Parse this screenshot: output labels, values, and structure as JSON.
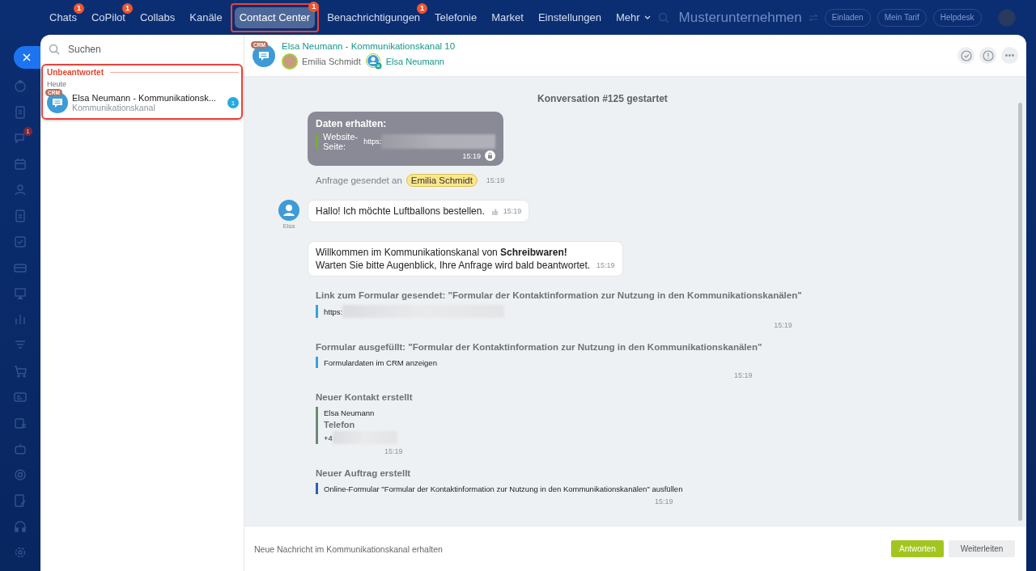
{
  "top_nav": {
    "items": [
      {
        "label": "Chats",
        "badge": "1",
        "selected": false,
        "highlighted": false
      },
      {
        "label": "CoPilot",
        "badge": "1",
        "selected": false,
        "highlighted": false
      },
      {
        "label": "Collabs",
        "selected": false,
        "highlighted": false
      },
      {
        "label": "Kanäle",
        "selected": false,
        "highlighted": false
      },
      {
        "label": "Contact Center",
        "badge": "1",
        "selected": true,
        "highlighted": true
      },
      {
        "label": "Benachrichtigungen",
        "badge": "1",
        "selected": false,
        "highlighted": false
      },
      {
        "label": "Telefonie",
        "selected": false,
        "highlighted": false
      },
      {
        "label": "Market",
        "selected": false,
        "highlighted": false
      },
      {
        "label": "Einstellungen",
        "selected": false,
        "highlighted": false
      },
      {
        "label": "Mehr",
        "kind": "dropdown",
        "selected": false,
        "highlighted": false
      }
    ]
  },
  "header_right": {
    "company": "Musterunternehmen",
    "buttons": [
      "Einladen",
      "Mein Tarif",
      "Helpdesk"
    ]
  },
  "rail": {
    "chat_badge": "1"
  },
  "list_panel": {
    "search": {
      "placeholder": "Suchen"
    },
    "unanswered": {
      "label": "Unbeantwortet",
      "highlighted": true,
      "groups": [
        {
          "label": "Heute",
          "items": [
            {
              "tag": "CRM",
              "title": "Elsa Neumann - Kommunikationsk...",
              "subtitle": "Kommunikationskanal",
              "count": "1",
              "selected": false
            }
          ]
        }
      ]
    }
  },
  "chat": {
    "header": {
      "tag": "CRM",
      "title": "Elsa Neumann - Kommunikationskanal 10",
      "members": [
        {
          "name": "Emilia Schmidt",
          "kind": "operator"
        },
        {
          "name": "Elsa Neumann",
          "kind": "client"
        }
      ]
    },
    "messages": [
      {
        "kind": "system",
        "text": "Konversation #**125** gestartet"
      },
      {
        "kind": "data",
        "title": "Daten erhalten:",
        "label": "Website-Seite:",
        "value": "https:",
        "time": "15:19"
      },
      {
        "kind": "request",
        "text": "Anfrage gesendet an",
        "tag": "Emilia Schmidt",
        "time": "15:19"
      },
      {
        "kind": "incoming",
        "author": "Elsa",
        "text": "Hallo! Ich möchte Luftballons bestellen.",
        "time": "15:19"
      },
      {
        "kind": "outgoing",
        "lines": [
          "Willkommen im Kommunikationskanal von **Schreibwaren!**",
          "Warten Sie bitte Augenblick, Ihre Anfrage wird bald beantwortet."
        ],
        "time": "15:19"
      },
      {
        "kind": "event",
        "title": "Link zum Formular gesendet: \"Formular der Kontaktinformation zur Nutzung in den Kommunikationskanälen\"",
        "color": "#3ba1dc",
        "lines": [
          {
            "kind": "redacted",
            "text": "https:"
          }
        ],
        "time": "15:19"
      },
      {
        "kind": "event",
        "title": "Formular ausgefüllt: \"Formular der Kontaktinformation zur Nutzung in den Kommunikationskanälen\"",
        "color": "#3ba1dc",
        "lines": [
          {
            "kind": "plain",
            "text": "Formulardaten im CRM anzeigen"
          }
        ],
        "time": "15:19"
      },
      {
        "kind": "event",
        "title": "Neuer Kontakt erstellt",
        "color": "#6b8a74",
        "lines": [
          {
            "kind": "plain",
            "text": "Elsa Neumann"
          },
          {
            "kind": "heading",
            "text": "Telefon"
          },
          {
            "kind": "redacted",
            "text": "+4"
          }
        ],
        "time": "15:19"
      },
      {
        "kind": "event",
        "title": "Neuer Auftrag erstellt",
        "color": "#2f5fb3",
        "lines": [
          {
            "kind": "plain",
            "text": "Online-Formular \"Formular der Kontaktinformation zur Nutzung in den Kommunikationskanälen\" ausfüllen"
          }
        ],
        "time": "15:19"
      }
    ],
    "footer": {
      "notice": "Neue Nachricht im Kommunikationskanal erhalten",
      "buttons": [
        {
          "label": "Antworten",
          "kind": "primary"
        },
        {
          "label": "Weiterleiten",
          "kind": "secondary"
        }
      ]
    }
  }
}
